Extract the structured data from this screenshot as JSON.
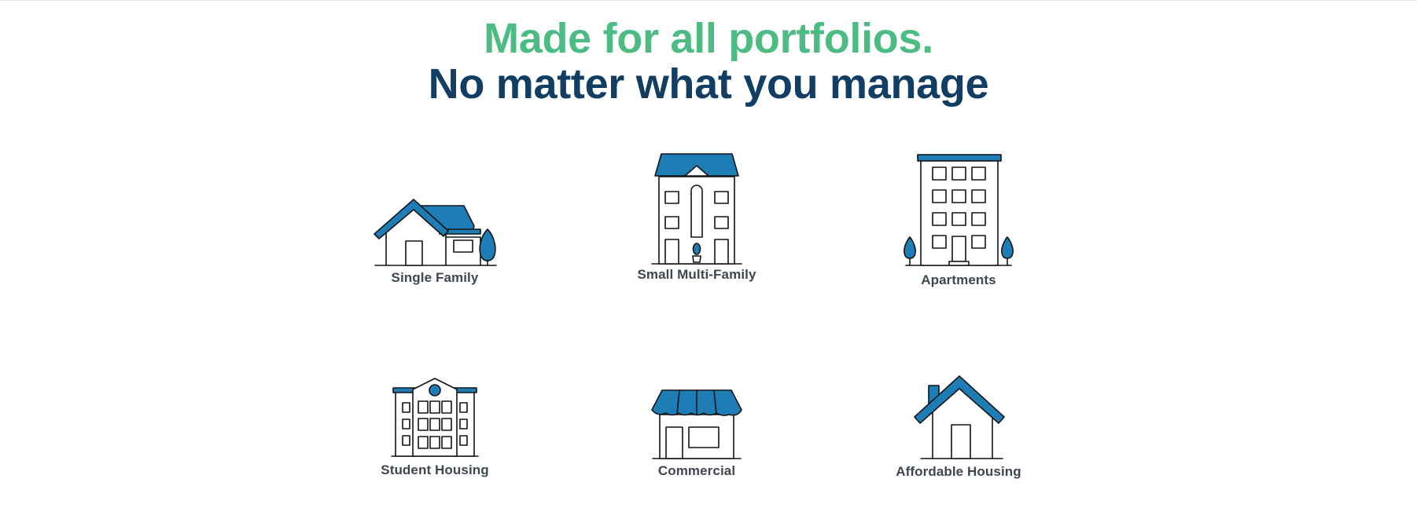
{
  "headline": {
    "line1": "Made for all portfolios.",
    "line2": "No matter what you manage"
  },
  "colors": {
    "accent_green": "#4cbc84",
    "heading_navy": "#123e64",
    "icon_blue": "#1f7db6",
    "label_gray": "#3f4650"
  },
  "portfolio_types": [
    {
      "label": "Single Family",
      "icon": "single-family-house-icon"
    },
    {
      "label": "Small Multi-Family",
      "icon": "small-multi-family-building-icon"
    },
    {
      "label": "Apartments",
      "icon": "apartment-building-icon"
    },
    {
      "label": "Student Housing",
      "icon": "student-housing-building-icon"
    },
    {
      "label": "Commercial",
      "icon": "commercial-storefront-icon"
    },
    {
      "label": "Affordable Housing",
      "icon": "affordable-housing-icon"
    }
  ]
}
